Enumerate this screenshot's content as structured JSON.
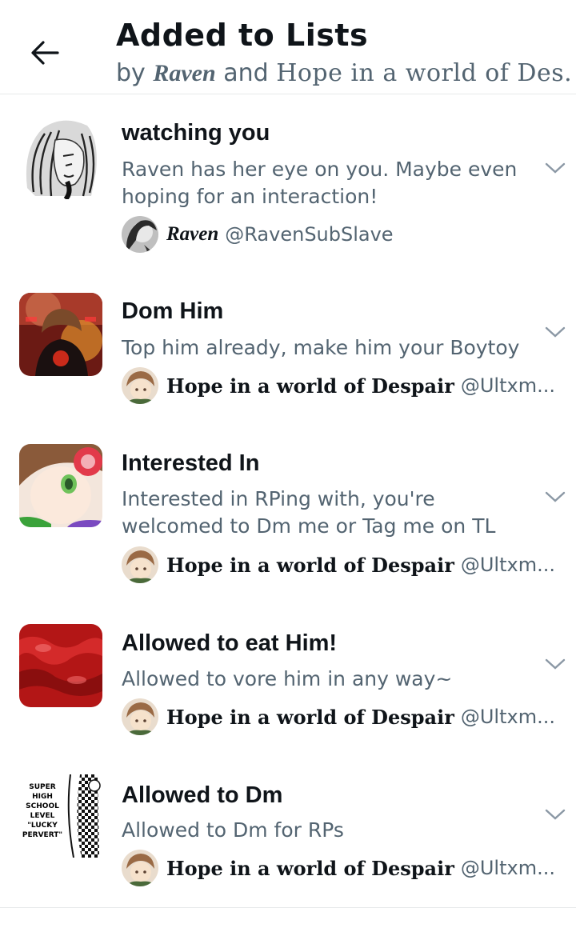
{
  "header": {
    "title": "Added to Lists",
    "subtitle_prefix": "by ",
    "subtitle_name1": "Raven",
    "subtitle_and": " and ",
    "subtitle_name2": "Hope in a world of Des..."
  },
  "lists": [
    {
      "name": "watching you",
      "description": "Raven has her eye on you. Maybe even hoping for an interaction!",
      "owner_name": "Raven",
      "owner_handle": "@RavenSubSlave",
      "thumb_icon": "manga-portrait-thumbnail"
    },
    {
      "name": "Dom Him",
      "description": "Top him already, make him your Boytoy",
      "owner_name": "Hope in a world of Despair",
      "owner_handle": "@Ultxm...",
      "thumb_icon": "red-portrait-thumbnail"
    },
    {
      "name": "Interested In",
      "description": "Interested in RPing with, you're welcomed to Dm me or Tag me on TL",
      "owner_name": "Hope in a world of Despair",
      "owner_handle": "@Ultxm...",
      "thumb_icon": "anime-face-thumbnail"
    },
    {
      "name": "Allowed to eat Him!",
      "description": "Allowed to vore him in any way~",
      "owner_name": "Hope in a world of Despair",
      "owner_handle": "@Ultxm...",
      "thumb_icon": "red-texture-thumbnail"
    },
    {
      "name": "Allowed to Dm",
      "description": "Allowed to Dm for RPs",
      "owner_name": "Hope in a world of Despair",
      "owner_handle": "@Ultxm...",
      "thumb_icon": "manga-panel-thumbnail",
      "thumb_text": "SUPER HIGH SCHOOL LEVEL \"LUCKY PERVERT\""
    }
  ],
  "colors": {
    "text_primary": "#0f1419",
    "text_secondary": "#536471",
    "divider": "#e7e9ea"
  }
}
